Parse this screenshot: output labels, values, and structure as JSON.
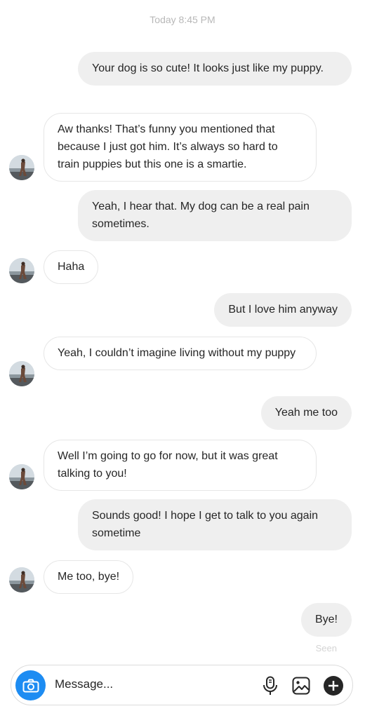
{
  "header": {
    "timestamp": "Today 8:45 PM"
  },
  "messages": [
    {
      "from": "me",
      "text": "Your dog is so cute! It looks just like my puppy."
    },
    {
      "from": "them",
      "text": "Aw thanks! That’s funny you mentioned that because I just got him. It’s always so hard to train puppies but this one is a smartie."
    },
    {
      "from": "me",
      "text": "Yeah, I hear that. My dog can be a real pain sometimes."
    },
    {
      "from": "them",
      "text": "Haha"
    },
    {
      "from": "me",
      "text": "But I love him anyway"
    },
    {
      "from": "them",
      "text": "Yeah, I couldn’t imagine living without my puppy"
    },
    {
      "from": "me",
      "text": "Yeah me too"
    },
    {
      "from": "them",
      "text": "Well I’m going to go for now, but it was great talking to you!"
    },
    {
      "from": "me",
      "text": "Sounds good! I hope I get to talk to you again sometime"
    },
    {
      "from": "them",
      "text": "Me too, bye!"
    },
    {
      "from": "me",
      "text": "Bye!"
    }
  ],
  "status": {
    "seen": "Seen"
  },
  "composer": {
    "placeholder": "Message...",
    "icons": [
      "camera-icon",
      "microphone-icon",
      "gallery-icon",
      "plus-icon"
    ]
  },
  "colors": {
    "accent": "#1d8cf2",
    "sent_bubble": "#efefef",
    "received_border": "#e6e6e6"
  }
}
